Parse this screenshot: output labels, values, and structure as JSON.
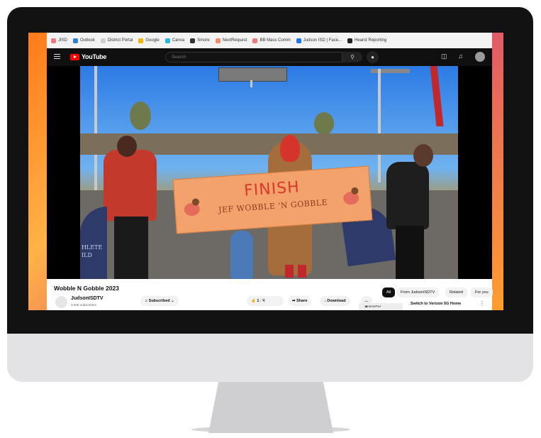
{
  "bookmarks": [
    {
      "label": "JISD",
      "color": "#f07a7a"
    },
    {
      "label": "Outlook",
      "color": "#2f7fd8"
    },
    {
      "label": "District Portal",
      "color": "#cfcfcf"
    },
    {
      "label": "Google",
      "color": "#f4b400"
    },
    {
      "label": "Canva",
      "color": "#29b6e0"
    },
    {
      "label": "Smore",
      "color": "#333333"
    },
    {
      "label": "NextRequest",
      "color": "#f08c6a"
    },
    {
      "label": "BB Mass Comm",
      "color": "#f07a7a"
    },
    {
      "label": "Judson ISD | Face...",
      "color": "#1877f2"
    },
    {
      "label": "Hearst Reporting",
      "color": "#222222"
    }
  ],
  "header": {
    "logo_text": "YouTube",
    "search_placeholder": "Search"
  },
  "video": {
    "banner_title": "FINISH",
    "banner_subtitle": "JEF WOBBLE 'N GOBBLE",
    "sponsor_text": "HLETE ILD"
  },
  "below": {
    "title": "Wobble N Gobble 2023",
    "channel_name": "JudsonISDTV",
    "subscribers": "3.04K subscribers",
    "subscribed_label": "Subscribed",
    "like_count": "1",
    "share_label": "Share",
    "download_label": "Download",
    "more_label": "…",
    "chips": [
      "All",
      "From JudsonISDTV",
      "Related",
      "For you"
    ],
    "reco_title": "Switch to Verizon 5G Home",
    "reco_thumb_text": "◀HomePwr"
  },
  "colors": {
    "yt_red": "#ff0000",
    "header_bg": "#0f0f0f",
    "banner": "#f3a26b",
    "finish_text": "#d83a2b"
  }
}
